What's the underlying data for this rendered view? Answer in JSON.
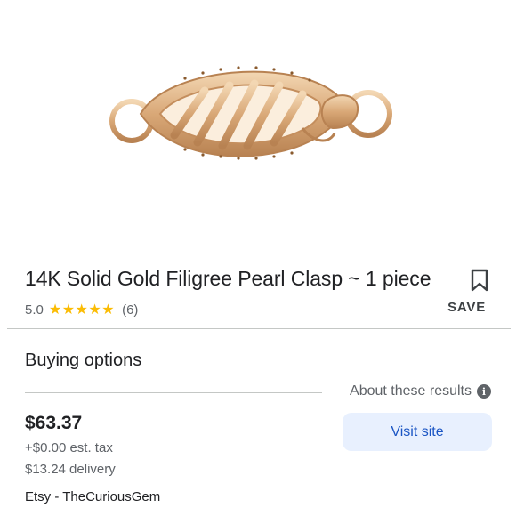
{
  "product": {
    "image_alt": "gold filigree pearl clasp",
    "title": "14K Solid Gold Filigree Pearl Clasp ~ 1 piece",
    "rating": "5.0",
    "stars": "★★★★★",
    "review_count": "(6)",
    "save_label": "SAVE"
  },
  "buying": {
    "section_title": "Buying options",
    "about_label": "About these results",
    "price": "$63.37",
    "tax": "+$0.00 est. tax",
    "delivery": "$13.24 delivery",
    "seller": "Etsy - TheCuriousGem",
    "visit_label": "Visit site"
  },
  "icons": {
    "bookmark": "bookmark-icon",
    "info": "info-icon"
  },
  "colors": {
    "star": "#fbbc04",
    "button_bg": "#e8f0fe",
    "button_text": "#1a55c4",
    "gold": "#d9a877"
  }
}
